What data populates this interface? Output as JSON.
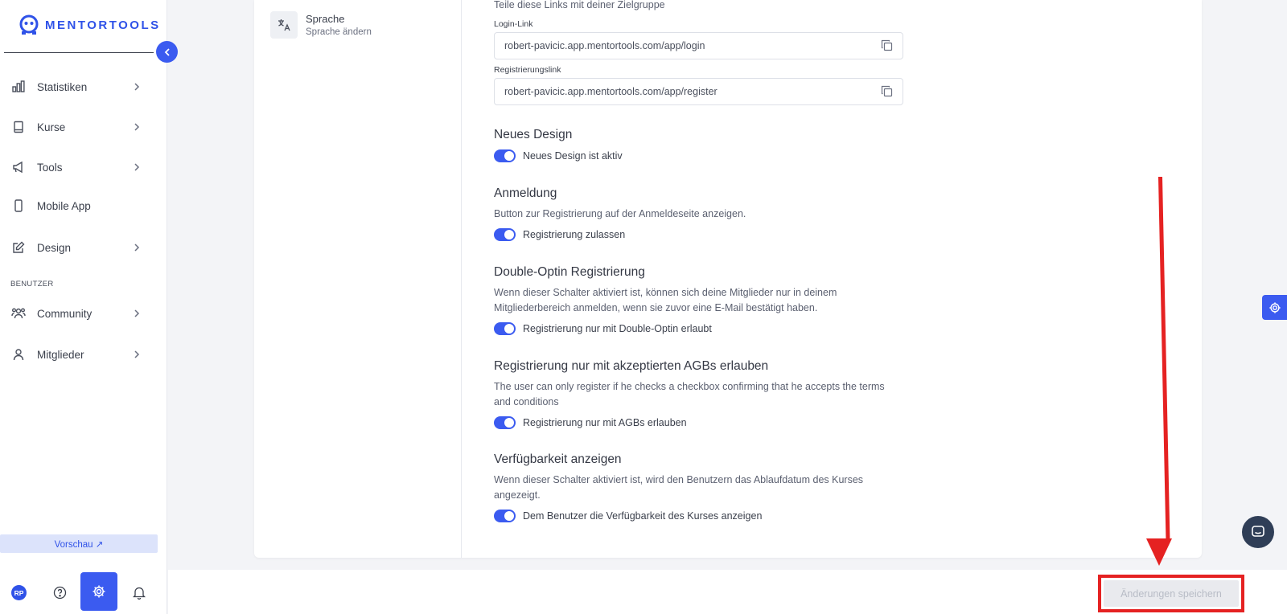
{
  "brand": {
    "name": "MENTORTOOLS",
    "accent": "#3b5bf0",
    "highlight": "#e52222"
  },
  "sidebar": {
    "items": [
      {
        "label": "Statistiken",
        "icon": "bar-chart-icon"
      },
      {
        "label": "Kurse",
        "icon": "book-icon"
      },
      {
        "label": "Tools",
        "icon": "megaphone-icon"
      },
      {
        "label": "Mobile App",
        "icon": "phone-icon"
      },
      {
        "label": "Design",
        "icon": "edit-icon"
      }
    ],
    "section_label": "BENUTZER",
    "user_items": [
      {
        "label": "Community",
        "icon": "users-icon"
      },
      {
        "label": "Mitglieder",
        "icon": "user-icon"
      }
    ],
    "preview_label": "Vorschau ↗",
    "avatar_initials": "RP"
  },
  "settings_nav": {
    "language": {
      "title": "Sprache",
      "subtitle": "Sprache ändern"
    }
  },
  "content": {
    "links_intro": "Teile diese Links mit deiner Zielgruppe",
    "login_label": "Login-Link",
    "login_value": "robert-pavicic.app.mentortools.com/app/login",
    "register_label": "Registrierungslink",
    "register_value": "robert-pavicic.app.mentortools.com/app/register",
    "sections": [
      {
        "title": "Neues Design",
        "desc": "",
        "toggle_label": "Neues Design ist aktiv",
        "enabled": true
      },
      {
        "title": "Anmeldung",
        "desc": "Button zur Registrierung auf der Anmeldeseite anzeigen.",
        "toggle_label": "Registrierung zulassen",
        "enabled": true
      },
      {
        "title": "Double-Optin Registrierung",
        "desc": "Wenn dieser Schalter aktiviert ist, können sich deine Mitglieder nur in deinem Mitgliederbereich anmelden, wenn sie zuvor eine E-Mail bestätigt haben.",
        "toggle_label": "Registrierung nur mit Double-Optin erlaubt",
        "enabled": true
      },
      {
        "title": "Registrierung nur mit akzeptierten AGBs erlauben",
        "desc": "The user can only register if he checks a checkbox confirming that he accepts the terms and conditions",
        "toggle_label": "Registrierung nur mit AGBs erlauben",
        "enabled": true
      },
      {
        "title": "Verfügbarkeit anzeigen",
        "desc": "Wenn dieser Schalter aktiviert ist, wird den Benutzern das Ablaufdatum des Kurses angezeigt.",
        "toggle_label": "Dem Benutzer die Verfügbarkeit des Kurses anzeigen",
        "enabled": true
      }
    ]
  },
  "footer": {
    "save_label": "Änderungen speichern"
  }
}
